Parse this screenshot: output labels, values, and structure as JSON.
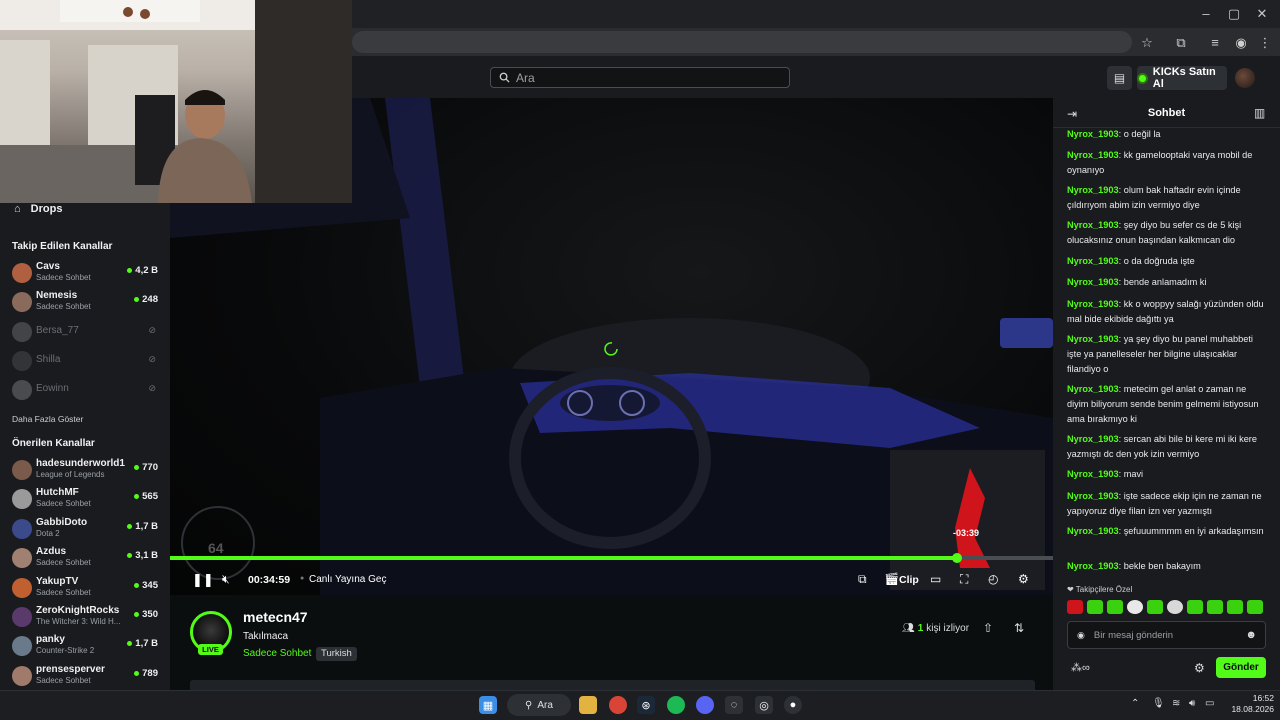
{
  "browser": {
    "window_controls": [
      "–",
      "▢",
      "✕"
    ]
  },
  "nav": {
    "search_placeholder": "Ara",
    "kicks_button": "KICKs Satın Al"
  },
  "sidebar": {
    "drops_label": "Drops",
    "followed_heading": "Takip Edilen Kanallar",
    "followed": [
      {
        "name": "Cavs",
        "category": "Sadece Sohbet",
        "viewers": "4,2 B",
        "live": true,
        "color": "#b06040"
      },
      {
        "name": "Nemesis",
        "category": "Sadece Sohbet",
        "viewers": "248",
        "live": true,
        "color": "#8a6a5a"
      },
      {
        "name": "Bersa_77",
        "live": false,
        "color": "#777"
      },
      {
        "name": "Shilla",
        "live": false,
        "color": "#555"
      },
      {
        "name": "Eowinn",
        "live": false,
        "color": "#888"
      }
    ],
    "show_more": "Daha Fazla Göster",
    "recommended_heading": "Önerilen Kanallar",
    "recommended": [
      {
        "name": "hadesunderworld1",
        "category": "League of Legends",
        "viewers": "770",
        "color": "#7a5a4a"
      },
      {
        "name": "HutchMF",
        "category": "Sadece Sohbet",
        "viewers": "565",
        "color": "#9a9a9a"
      },
      {
        "name": "GabbiDoto",
        "category": "Dota 2",
        "viewers": "1,7 B",
        "color": "#3a4a8a"
      },
      {
        "name": "Azdus",
        "category": "Sadece Sohbet",
        "viewers": "3,1 B",
        "color": "#a08070"
      },
      {
        "name": "YakupTV",
        "category": "Sadece Sohbet",
        "viewers": "345",
        "color": "#c06030"
      },
      {
        "name": "ZeroKnightRocks",
        "category": "The Witcher 3: Wild H...",
        "viewers": "350",
        "color": "#5a3a6a"
      },
      {
        "name": "panky",
        "category": "Counter-Strike 2",
        "viewers": "1,7 B",
        "color": "#6a7a8a"
      },
      {
        "name": "prensesperver",
        "category": "Sadece Sohbet",
        "viewers": "789",
        "color": "#a07a6a"
      }
    ]
  },
  "player": {
    "progress_fraction": 0.891,
    "hover_time": "-03:39",
    "elapsed": "00:34:59",
    "go_live": "Canlı Yayına Geç",
    "clip_label": "Clip",
    "speedometer": "64"
  },
  "stream": {
    "live_badge": "LIVE",
    "channel": "metecn47",
    "title": "Takılmaca",
    "category": "Sadece Sohbet",
    "tag": "Turkish",
    "viewer_count": "1",
    "viewer_suffix": "kişi izliyor"
  },
  "chat": {
    "title": "Sohbet",
    "messages": [
      {
        "user": "Nyrox_1903",
        "text": "o değil la"
      },
      {
        "user": "Nyrox_1903",
        "text": "kk gamelooptaki varya mobil de oynanıyo"
      },
      {
        "user": "Nyrox_1903",
        "text": "olum bak haftadır evin içinde çıldırıyom abim izin vermiyo diye"
      },
      {
        "user": "Nyrox_1903",
        "text": "şey diyo bu sefer cs de 5 kişi olucaksınız onun başından kalkmıcan dio"
      },
      {
        "user": "Nyrox_1903",
        "text": "o da doğruda işte"
      },
      {
        "user": "Nyrox_1903",
        "text": "bende anlamadım ki"
      },
      {
        "user": "Nyrox_1903",
        "text": "kk o woppyy salağı yüzünden oldu mal bide ekibide dağıttı ya"
      },
      {
        "user": "Nyrox_1903",
        "text": "ya şey diyo bu panel muhabbeti işte ya panelleseler her bilgine ulaşıcaklar filandiyo o"
      },
      {
        "user": "Nyrox_1903",
        "text": "metecim gel anlat o zaman ne diyim biliyorum sende benim gelmemi istiyosun ama bırakmıyo ki"
      },
      {
        "user": "Nyrox_1903",
        "text": "sercan abi bile bi kere mi iki kere yazmıştı dc den yok izin vermiyo"
      },
      {
        "user": "Nyrox_1903",
        "text": "mavi"
      },
      {
        "user": "Nyrox_1903",
        "text": "işte sadece ekip için ne zaman ne yapıyoruz diye filan izn ver yazmıştı"
      },
      {
        "user": "Nyrox_1903",
        "text": "şefuuummmm en iyi arkadaşımsın"
      },
      {
        "user": "Nyrox_1903",
        "text": "bekle ben bakayım"
      }
    ],
    "followers_label": "Takipçilere Özel",
    "input_placeholder": "Bir mesaj gönderin",
    "send_button": "Gönder"
  },
  "taskbar": {
    "search_label": "Ara",
    "time": "16:52",
    "date": "18.08.2026"
  }
}
